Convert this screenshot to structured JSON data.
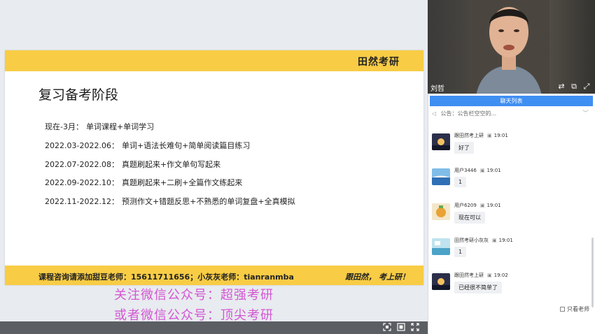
{
  "slide": {
    "brand": "田然考研",
    "title": "复习备考阶段",
    "plan": [
      {
        "date": "现在-3月：",
        "task": "单词课程+单词学习"
      },
      {
        "date": "2022.03-2022.06：",
        "task": "单词+语法长难句+简单阅读篇目练习"
      },
      {
        "date": "2022.07-2022.08：",
        "task": "真题刷起来+作文单句写起来"
      },
      {
        "date": "2022.09-2022.10：",
        "task": "真题刷起来+二刷+全篇作文练起来"
      },
      {
        "date": "2022.11-2022.12：",
        "task": "预测作文+错题反思+不熟悉的单词复盘+全真模拟"
      }
    ],
    "footer_contact": "课程咨询请添加甜豆老师：15611711656；小灰灰老师：tianranmba",
    "footer_slogan": "跟田然， 考上研！"
  },
  "overlay": {
    "line1": "关注微信公众号：超强考研",
    "line2": "或者微信公众号：顶尖考研"
  },
  "controls": {
    "icons": [
      "fit-screen-icon",
      "window-mode-icon",
      "fullscreen-icon"
    ]
  },
  "camera": {
    "name": "刘哲"
  },
  "chat": {
    "tab_label": "聊天列表",
    "notice": "公告：公告栏空空的...",
    "messages": [
      {
        "sender": "跟田然考上研",
        "time": "19:01",
        "text": "好了",
        "avatar_color": "#2b2f4a"
      },
      {
        "sender": "用户3446",
        "time": "19:01",
        "text": "1",
        "avatar_color": "#3c7fc7"
      },
      {
        "sender": "用户6209",
        "time": "19:01",
        "text": "现在可以",
        "avatar_color": "#e9b04a"
      },
      {
        "sender": "田然考研小灰灰",
        "time": "19:01",
        "text": "1",
        "avatar_color": "#5aa7c9"
      },
      {
        "sender": "跟田然考上研",
        "time": "19:02",
        "text": "已经很不简单了",
        "avatar_color": "#2b2f4a"
      }
    ],
    "only_teacher_label": "只看老师"
  }
}
